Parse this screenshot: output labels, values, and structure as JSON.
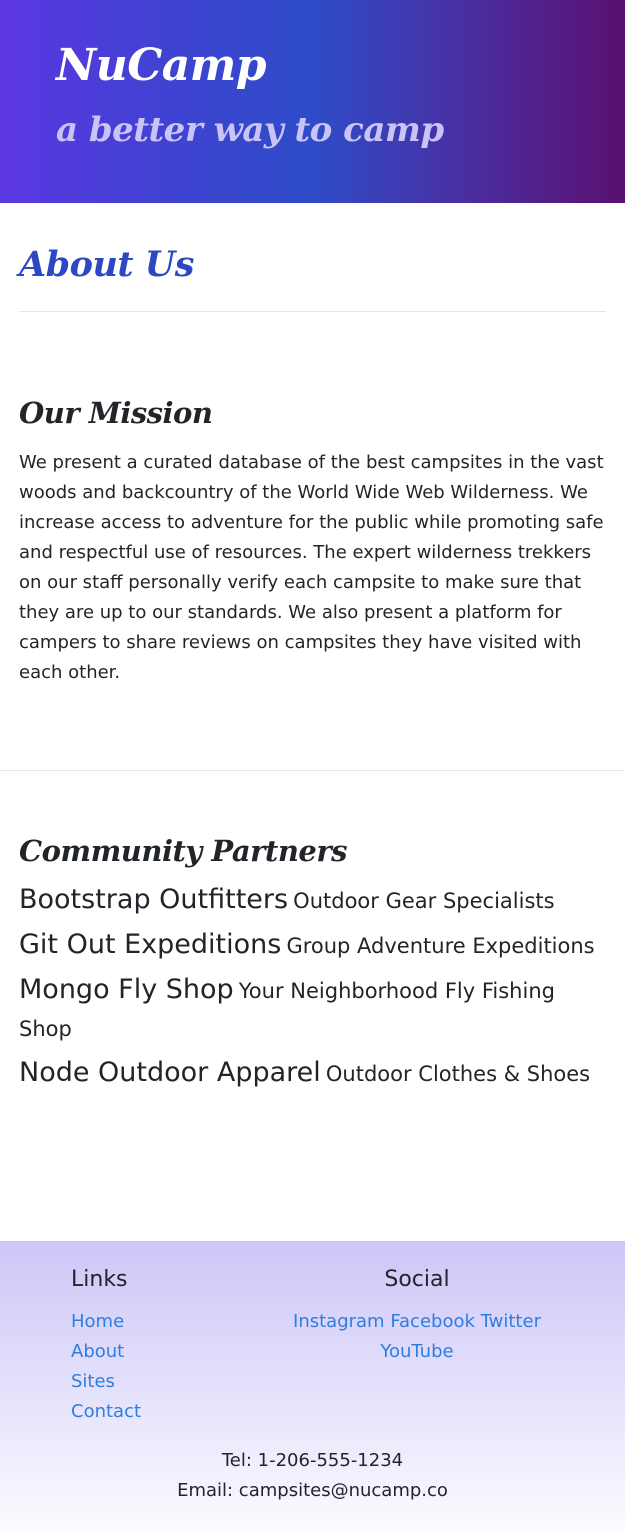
{
  "header": {
    "brand": "NuCamp",
    "tagline": "a better way to camp"
  },
  "page": {
    "title": "About Us"
  },
  "mission": {
    "heading": "Our Mission",
    "text": "We present a curated database of the best campsites in the vast woods and backcountry of the World Wide Web Wilderness. We increase access to adventure for the public while promoting safe and respectful use of resources. The expert wilderness trekkers on our staff personally verify each campsite to make sure that they are up to our standards. We also present a platform for campers to share reviews on campsites they have visited with each other."
  },
  "partners": {
    "heading": "Community Partners",
    "items": [
      {
        "name": "Bootstrap Outfitters",
        "description": "Outdoor Gear Specialists"
      },
      {
        "name": "Git Out Expeditions",
        "description": "Group Adventure Expeditions"
      },
      {
        "name": "Mongo Fly Shop",
        "description": "Your Neighborhood Fly Fishing Shop"
      },
      {
        "name": "Node Outdoor Apparel",
        "description": "Outdoor Clothes & Shoes"
      }
    ]
  },
  "footer": {
    "links_title": "Links",
    "links": [
      "Home",
      "About",
      "Sites",
      "Contact"
    ],
    "social_title": "Social",
    "social": [
      "Instagram",
      "Facebook",
      "Twitter",
      "YouTube"
    ],
    "tel": "Tel: 1-206-555-1234",
    "email": "Email: campsites@nucamp.co"
  },
  "colors": {
    "accent": "#2e48c4",
    "link": "#2f7de1",
    "tagline": "#c9c3f7"
  }
}
